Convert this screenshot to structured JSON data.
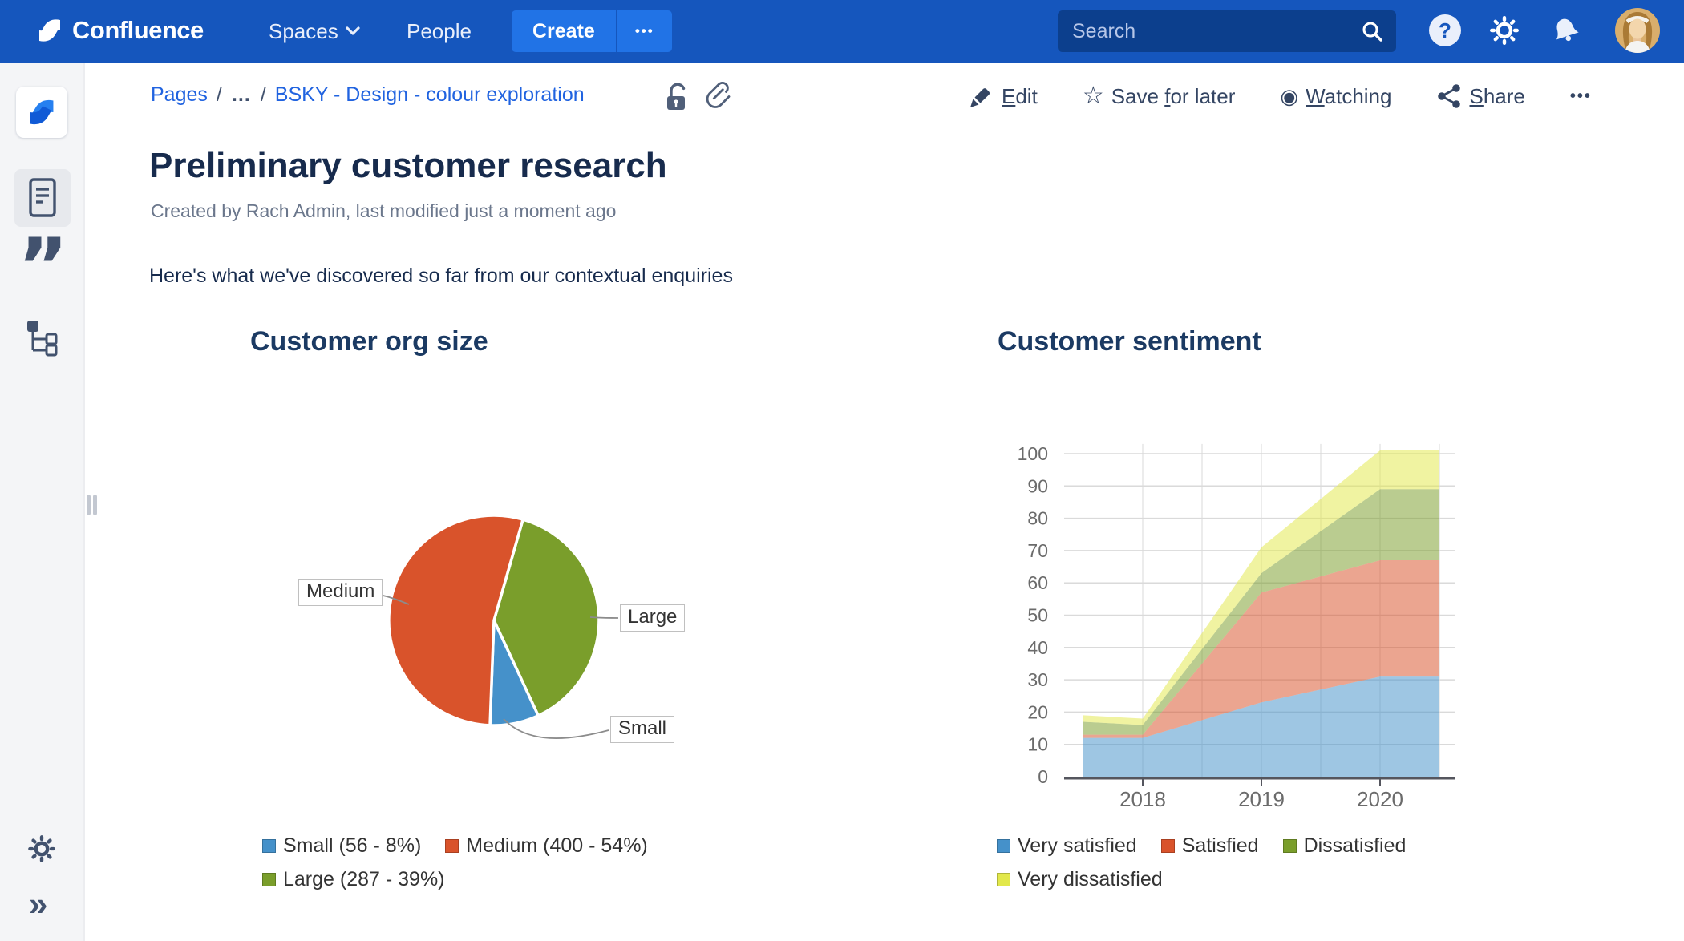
{
  "header": {
    "product": "Confluence",
    "nav": [
      {
        "label": "Spaces"
      },
      {
        "label": "People"
      }
    ],
    "create_label": "Create",
    "create_more": "•••",
    "search_placeholder": "Search"
  },
  "breadcrumb": {
    "items": [
      "Pages",
      "…",
      "BSKY - Design - colour exploration"
    ],
    "separator": "/"
  },
  "actions": {
    "edit": [
      "",
      "E",
      "dit"
    ],
    "save": [
      "Save ",
      "f",
      "or later"
    ],
    "watch": [
      "",
      "W",
      "atching"
    ],
    "share": [
      "",
      "S",
      "hare"
    ],
    "more": "•••"
  },
  "article": {
    "title": "Preliminary customer research",
    "byline": "Created by Rach Admin, last modified just a moment ago",
    "intro": "Here's what we've discovered so far from our contextual enquiries"
  },
  "chart_data": [
    {
      "type": "pie",
      "title": "Customer org size",
      "start_angle_deg": 16,
      "slices": [
        {
          "label": "Large",
          "value": 287,
          "pct": "39%",
          "color": "#7A9E2B"
        },
        {
          "label": "Small",
          "value": 56,
          "pct": "8%",
          "color": "#4591CA"
        },
        {
          "label": "Medium",
          "value": 400,
          "pct": "54%",
          "color": "#D9532B"
        }
      ],
      "legend": [
        {
          "label": "Small (56 - 8%)",
          "color": "#4591CA"
        },
        {
          "label": "Medium (400 - 54%)",
          "color": "#D9532B"
        },
        {
          "label": "Large (287 - 39%)",
          "color": "#7A9E2B"
        }
      ]
    },
    {
      "type": "area",
      "title": "Customer sentiment",
      "stacked": true,
      "x": [
        2017.5,
        2018,
        2019,
        2020,
        2020.5
      ],
      "x_ticks": [
        2018,
        2019,
        2020
      ],
      "x_tick_labels": [
        "2018",
        "2019",
        "2020"
      ],
      "ylim": [
        0,
        100
      ],
      "y_tick_step": 10,
      "grid": true,
      "legend_position": "bottom",
      "series": [
        {
          "name": "Very satisfied",
          "color": "#4591CA",
          "values": [
            12,
            12,
            23,
            31,
            31
          ]
        },
        {
          "name": "Satisfied",
          "color": "#D9532B",
          "values": [
            1,
            1,
            34,
            36,
            36
          ]
        },
        {
          "name": "Dissatisfied",
          "color": "#7A9E2B",
          "values": [
            4,
            3,
            6,
            22,
            22
          ]
        },
        {
          "name": "Very dissatisfied",
          "color": "#E2E84B",
          "values": [
            2,
            2,
            8,
            12,
            12
          ]
        }
      ]
    }
  ]
}
